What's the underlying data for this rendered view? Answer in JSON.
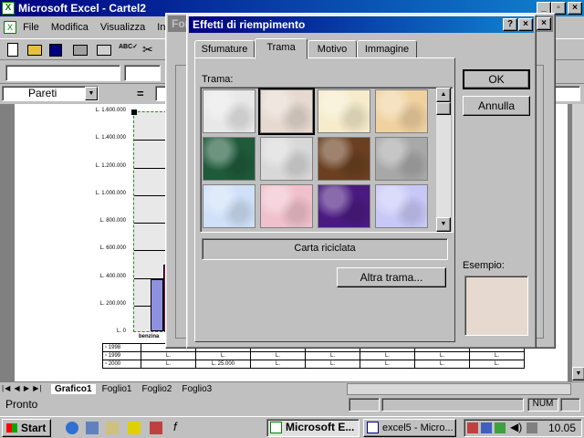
{
  "excel": {
    "title": "Microsoft Excel - Cartel2",
    "menu": [
      "File",
      "Modifica",
      "Visualizza",
      "Inse"
    ],
    "name_box": "Pareti",
    "status": "Pronto",
    "num_indicator": "NUM",
    "sheet_tabs": [
      "Grafico1",
      "Foglio1",
      "Foglio2",
      "Foglio3"
    ]
  },
  "chart": {
    "y_labels": [
      "L. 1.600.000",
      "L. 1.400.000",
      "L. 1.200.000",
      "L. 1.000.000",
      "L. 800.000",
      "L. 600.000",
      "L. 400.000",
      "L. 200.000",
      "L. 0"
    ],
    "category_label": "benzina",
    "table_rows": [
      {
        "label": "1998",
        "cells": [
          "L.",
          "L.",
          "L.",
          "L.",
          "L.",
          "L.",
          "L."
        ]
      },
      {
        "label": "1999",
        "cells": [
          "L.",
          "L.",
          "L.",
          "L.",
          "L.",
          "L.",
          "L."
        ]
      },
      {
        "label": "2000",
        "cells": [
          "L.",
          "L. 25.000",
          "L.",
          "L.",
          "L.",
          "L.",
          "L."
        ]
      }
    ]
  },
  "chart_data": {
    "type": "bar",
    "categories": [
      "benzina"
    ],
    "series": [
      {
        "name": "1998",
        "values": [
          0
        ]
      },
      {
        "name": "1999",
        "values": [
          380000
        ]
      },
      {
        "name": "2000",
        "values": [
          480000
        ]
      }
    ],
    "ylim": [
      0,
      1600000
    ]
  },
  "behind_dialog": {
    "title": "For"
  },
  "dialog": {
    "title": "Effetti di riempimento",
    "tabs": [
      "Sfumature",
      "Trama",
      "Motivo",
      "Immagine"
    ],
    "active_tab": "Trama",
    "texture_label": "Trama:",
    "selected_name": "Carta riciclata",
    "more_button": "Altra trama...",
    "ok_button": "OK",
    "cancel_button": "Annulla",
    "example_label": "Esempio:"
  },
  "textures": [
    {
      "name": "texture-white-marble",
      "color": "#e8e8e8"
    },
    {
      "name": "texture-recycled-paper",
      "color": "#e6d9d0"
    },
    {
      "name": "texture-parchment",
      "color": "#f6eccb"
    },
    {
      "name": "texture-sand",
      "color": "#f0d2a0"
    },
    {
      "name": "texture-green-marble",
      "color": "#1f5a3a"
    },
    {
      "name": "texture-gray-marble",
      "color": "#d8d8d8"
    },
    {
      "name": "texture-brown-marble",
      "color": "#6a4020"
    },
    {
      "name": "texture-granite",
      "color": "#a8a8a8"
    },
    {
      "name": "texture-blue-tissue",
      "color": "#cfe0f8"
    },
    {
      "name": "texture-pink-tissue",
      "color": "#f0c0cc"
    },
    {
      "name": "texture-purple-mesh",
      "color": "#4a1a80"
    },
    {
      "name": "texture-bouquet",
      "color": "#c8c8f8"
    }
  ],
  "taskbar": {
    "start": "Start",
    "tasks": [
      "Microsoft E...",
      "excel5 - Micro..."
    ],
    "clock": "10.05"
  }
}
